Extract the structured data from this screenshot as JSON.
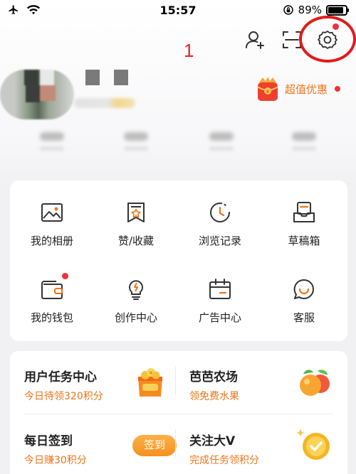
{
  "status_bar": {
    "time": "15:57",
    "battery": "89%",
    "battery_level": 0.89
  },
  "annotation": {
    "number": "1"
  },
  "top_bar": {
    "icons": [
      "add-friend-icon",
      "scan-icon",
      "settings-icon"
    ]
  },
  "profile": {
    "promo_label": "超值优惠"
  },
  "tools": [
    {
      "label": "我的相册",
      "icon": "photo-album-icon"
    },
    {
      "label": "赞/收藏",
      "icon": "favorites-icon"
    },
    {
      "label": "浏览记录",
      "icon": "history-icon"
    },
    {
      "label": "草稿箱",
      "icon": "drafts-icon"
    },
    {
      "label": "我的钱包",
      "icon": "wallet-icon"
    },
    {
      "label": "创作中心",
      "icon": "creator-center-icon"
    },
    {
      "label": "广告中心",
      "icon": "ad-center-icon"
    },
    {
      "label": "客服",
      "icon": "customer-service-icon"
    }
  ],
  "tasks": {
    "user_task_center": {
      "title": "用户任务中心",
      "subtitle": "今日待领320积分"
    },
    "baba_farm": {
      "title": "芭芭农场",
      "subtitle": "领免费水果"
    },
    "daily_signin": {
      "title": "每日签到",
      "subtitle": "今日赚30积分",
      "button": "签到"
    },
    "follow_v": {
      "title": "关注大V",
      "subtitle": "完成任务领积分"
    }
  },
  "colors": {
    "accent_orange": "#f0741a",
    "badge_red": "#f0303c",
    "annotation_red": "#e21b1b"
  }
}
